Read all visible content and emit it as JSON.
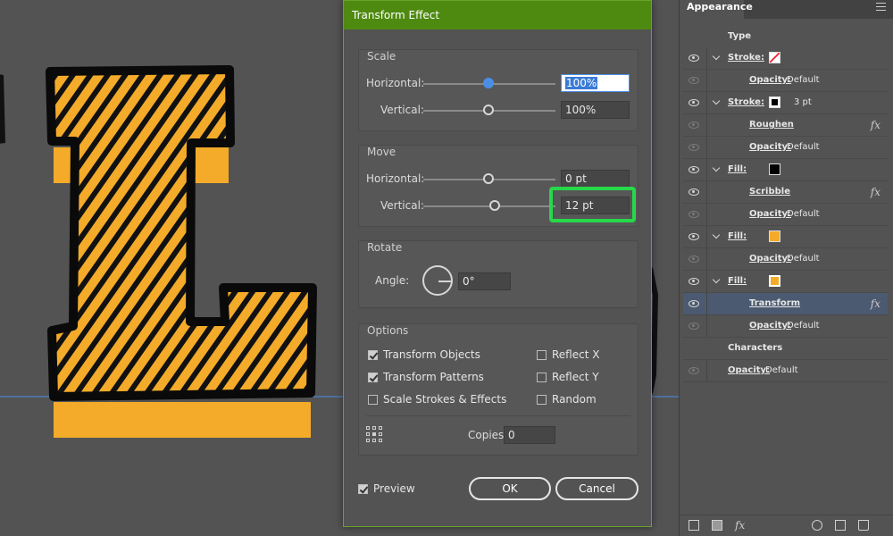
{
  "dialog": {
    "title": "Transform Effect",
    "scale": {
      "title": "Scale",
      "horizontal_label": "Horizontal:",
      "horizontal_value": "100%",
      "vertical_label": "Vertical:",
      "vertical_value": "100%"
    },
    "move": {
      "title": "Move",
      "horizontal_label": "Horizontal:",
      "horizontal_value": "0 pt",
      "vertical_label": "Vertical:",
      "vertical_value": "12 pt"
    },
    "rotate": {
      "title": "Rotate",
      "angle_label": "Angle:",
      "angle_value": "0°"
    },
    "options": {
      "title": "Options",
      "transform_objects": "Transform Objects",
      "transform_patterns": "Transform Patterns",
      "scale_strokes": "Scale Strokes & Effects",
      "reflect_x": "Reflect X",
      "reflect_y": "Reflect Y",
      "random": "Random",
      "copies_label": "Copies",
      "copies_value": "0"
    },
    "preview_label": "Preview",
    "ok_label": "OK",
    "cancel_label": "Cancel"
  },
  "panel": {
    "tab_label": "Appearance",
    "header": "Type",
    "rows": [
      {
        "name": "Stroke:",
        "value": ""
      },
      {
        "name": "Opacity:",
        "value": "Default"
      },
      {
        "name": "Stroke:",
        "value": "3 pt"
      },
      {
        "name": "Roughen",
        "value": ""
      },
      {
        "name": "Opacity:",
        "value": "Default"
      },
      {
        "name": "Fill:",
        "value": ""
      },
      {
        "name": "Scribble",
        "value": ""
      },
      {
        "name": "Opacity:",
        "value": "Default"
      },
      {
        "name": "Fill:",
        "value": ""
      },
      {
        "name": "Opacity:",
        "value": "Default"
      },
      {
        "name": "Fill:",
        "value": ""
      },
      {
        "name": "Transform",
        "value": ""
      },
      {
        "name": "Opacity:",
        "value": "Default"
      },
      {
        "name": "Characters",
        "value": ""
      },
      {
        "name": "Opacity:",
        "value": "Default"
      }
    ],
    "fx_label": "fx"
  },
  "colors": {
    "accent_green": "#4e8a10",
    "highlight": "#27d84a",
    "letter_fill": "#f4ab2a",
    "selection": "#4b5a70"
  }
}
